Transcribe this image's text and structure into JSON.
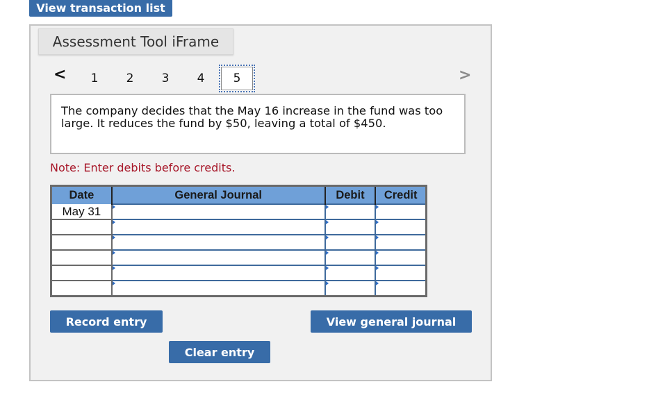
{
  "header": {
    "view_transaction_list_label": "View transaction list"
  },
  "panel": {
    "tab_title": "Assessment Tool iFrame"
  },
  "pagination": {
    "prev_icon": "chevron-left",
    "next_icon": "chevron-right",
    "prev_glyph": "<",
    "next_glyph": ">",
    "pages": [
      "1",
      "2",
      "3",
      "4",
      "5"
    ],
    "current_page": "5"
  },
  "question": {
    "text": "The company decides that the May 16 increase in the fund was too large. It reduces the fund by $50, leaving a total of $450."
  },
  "note": {
    "text": "Note: Enter debits before credits."
  },
  "journal": {
    "columns": [
      "Date",
      "General Journal",
      "Debit",
      "Credit"
    ],
    "rows": [
      {
        "date": "May 31",
        "account": "",
        "debit": "",
        "credit": ""
      },
      {
        "date": "",
        "account": "",
        "debit": "",
        "credit": ""
      },
      {
        "date": "",
        "account": "",
        "debit": "",
        "credit": ""
      },
      {
        "date": "",
        "account": "",
        "debit": "",
        "credit": ""
      },
      {
        "date": "",
        "account": "",
        "debit": "",
        "credit": ""
      },
      {
        "date": "",
        "account": "",
        "debit": "",
        "credit": ""
      }
    ]
  },
  "buttons": {
    "record_entry": "Record entry",
    "clear_entry": "Clear entry",
    "view_general_journal": "View general journal"
  },
  "colors": {
    "button_blue": "#386ca8",
    "header_blue": "#6fa0d8",
    "note_red": "#a8182a",
    "panel_bg": "#f1f1f1"
  }
}
